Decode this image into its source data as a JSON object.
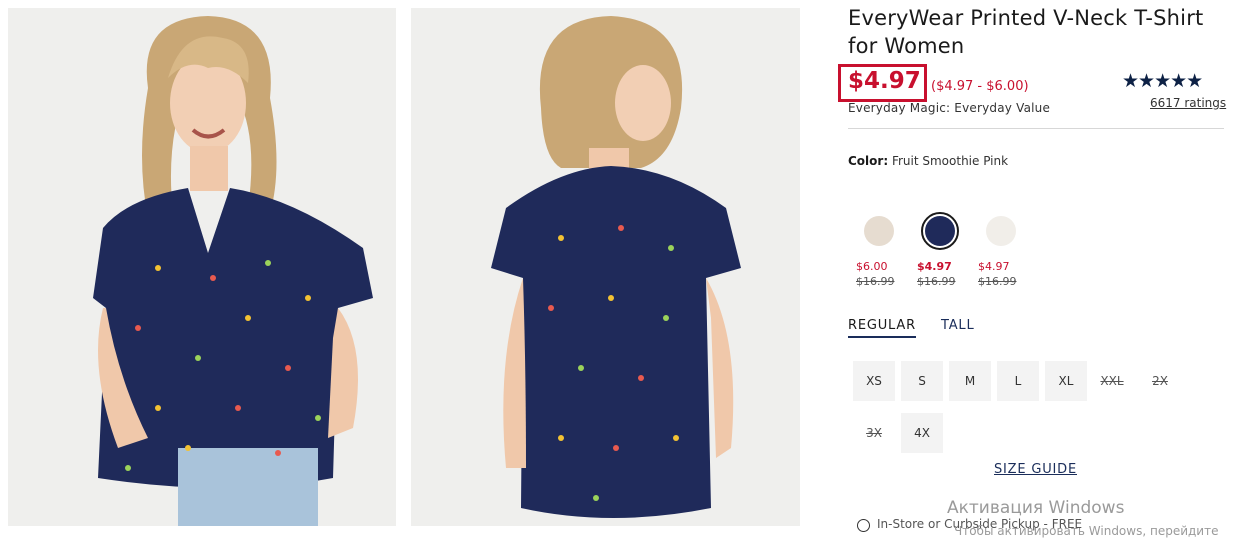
{
  "product": {
    "title": "EveryWear Printed V-Neck T-Shirt for Women",
    "price": "$4.97",
    "price_range": "($4.97 - $6.00)",
    "value_note": "Everyday Magic: Everyday Value",
    "rating_stars": "★★★★★",
    "rating_fraction": 0.9,
    "ratings_link": "6617 ratings"
  },
  "color": {
    "label": "Color:",
    "value": "Fruit Smoothie Pink",
    "swatches": [
      {
        "price": "$6.00",
        "was": "$16.99",
        "color": "#e6dcd0",
        "icon": "speckled-swatch-icon"
      },
      {
        "price": "$4.97",
        "was": "$16.99",
        "color": "#1f2a5a",
        "icon": "navy-swatch-icon",
        "selected": true
      },
      {
        "price": "$4.97",
        "was": "$16.99",
        "color": "#f1eee9",
        "icon": "fruit-swatch-icon"
      }
    ]
  },
  "fit_tabs": [
    "REGULAR",
    "TALL"
  ],
  "sizes": [
    {
      "label": "XS",
      "available": true
    },
    {
      "label": "S",
      "available": true
    },
    {
      "label": "M",
      "available": true
    },
    {
      "label": "L",
      "available": true
    },
    {
      "label": "XL",
      "available": true
    },
    {
      "label": "XXL",
      "available": false
    },
    {
      "label": "2X",
      "available": false
    },
    {
      "label": "3X",
      "available": false
    },
    {
      "label": "4X",
      "available": true
    }
  ],
  "size_guide": "SIZE GUIDE",
  "pickup": "In-Store or Curbside Pickup - FREE",
  "os_watermark": {
    "line1": "Активация Windows",
    "line2": "Чтобы активировать Windows, перейдите"
  },
  "colors": {
    "sale_red": "#c8102e",
    "navy": "#1a2d5a",
    "shirt_navy": "#1f2a5a"
  }
}
